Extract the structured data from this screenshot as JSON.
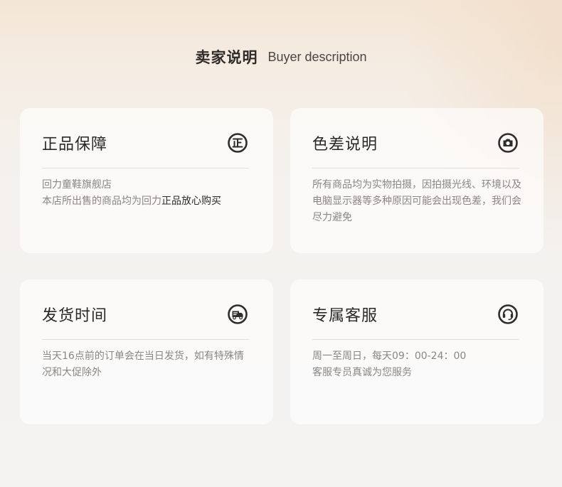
{
  "header": {
    "title_cn": "卖家说明",
    "title_en": "Buyer description"
  },
  "cards": [
    {
      "title": "正品保障",
      "icon": "authentic-icon",
      "line1": "回力童鞋旗舰店",
      "line2_prefix": "本店所出售的商品均为回力",
      "line2_emphasis": "正品放心购买"
    },
    {
      "title": "色差说明",
      "icon": "camera-icon",
      "body": "所有商品均为实物拍摄，因拍摄光线、环境以及电脑显示器等多种原因可能会出现色差，我们会尽力避免"
    },
    {
      "title": "发货时间",
      "icon": "delivery-truck-icon",
      "body": "当天16点前的订单会在当日发货，如有特殊情况和大促除外"
    },
    {
      "title": "专属客服",
      "icon": "headset-icon",
      "line1": "周一至周日，每天09：00-24：00",
      "line2": "客服专员真诚为您服务"
    }
  ],
  "colors": {
    "title": "#2b2928",
    "body_text": "#8a8685",
    "emphasis_text": "#2e2b2a",
    "icon": "#2f2d2c"
  }
}
